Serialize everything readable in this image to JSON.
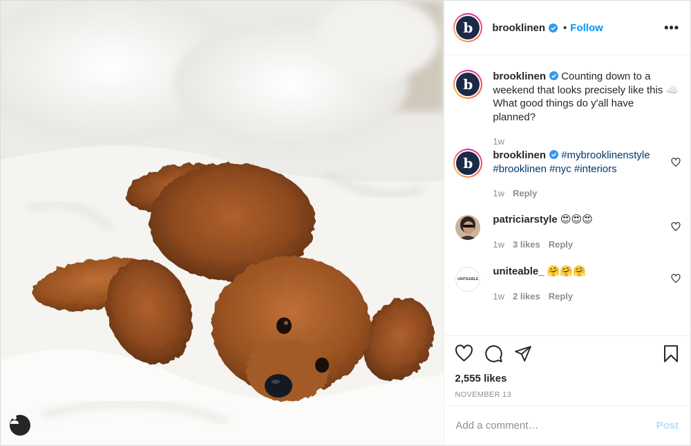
{
  "header": {
    "username": "brooklinen",
    "dot": "•",
    "follow_label": "Follow",
    "more_label": "•••",
    "avatar_letter": "b"
  },
  "caption": {
    "username": "brooklinen",
    "text": "Counting down to a weekend that looks precisely like this ☁️ What good things do y'all have planned?",
    "time": "1w"
  },
  "comments": [
    {
      "username": "brooklinen",
      "text": "#mybrooklinenstyle #brooklinen #nyc #interiors",
      "time": "1w",
      "reply": "Reply"
    },
    {
      "username": "patriciarstyle",
      "text": "😍😍😍",
      "time": "1w",
      "likes": "3 likes",
      "reply": "Reply"
    },
    {
      "username": "uniteable_",
      "text": "🤗🤗🤗",
      "time": "1w",
      "likes": "2 likes",
      "reply": "Reply",
      "avatar_text": "UNITEABLE"
    }
  ],
  "likes": "2,555 likes",
  "date": "NOVEMBER 13",
  "add_comment": {
    "placeholder": "Add a comment…",
    "post_label": "Post"
  },
  "colors": {
    "accent": "#0095f6",
    "hashtag": "#00376b",
    "muted": "#8e8e8e",
    "post_disabled": "#b2dffc"
  },
  "icons": [
    "verified-badge-icon",
    "heart-icon",
    "comment-icon",
    "share-icon",
    "bookmark-icon",
    "user-tag-icon",
    "more-icon"
  ]
}
